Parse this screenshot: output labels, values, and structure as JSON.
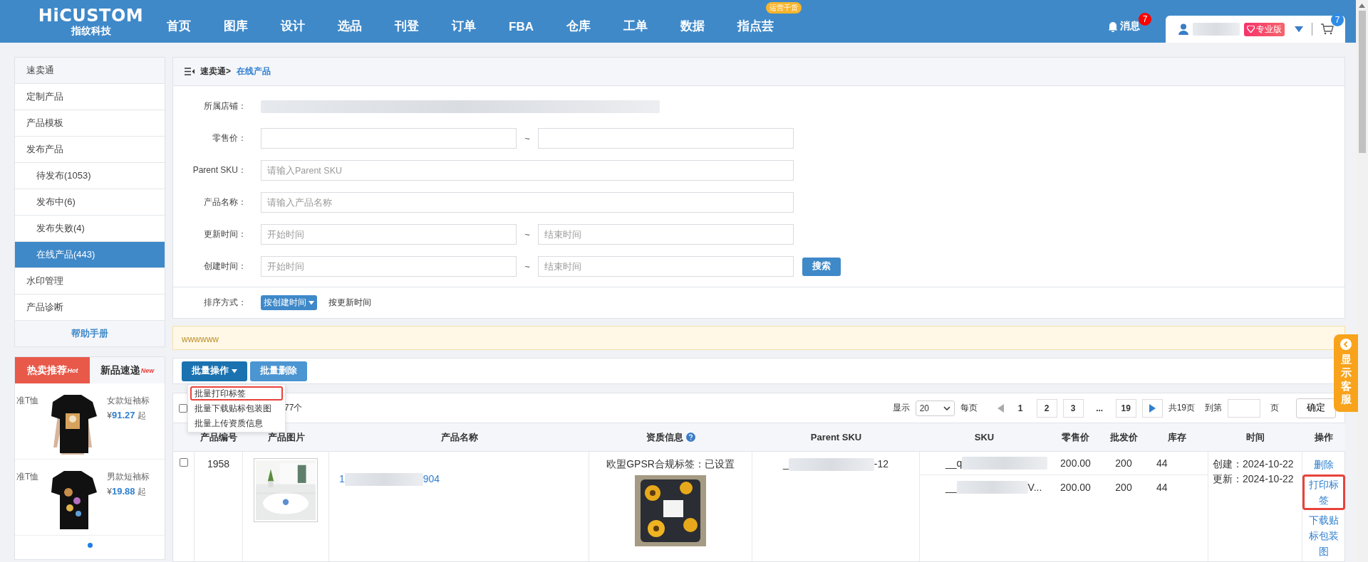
{
  "header": {
    "logo": {
      "title": "HiCUSTOM",
      "subtitle": "指纹科技"
    },
    "nav": [
      {
        "label": "首页"
      },
      {
        "label": "图库"
      },
      {
        "label": "设计"
      },
      {
        "label": "选品"
      },
      {
        "label": "刊登"
      },
      {
        "label": "订单"
      },
      {
        "label": "FBA"
      },
      {
        "label": "仓库"
      },
      {
        "label": "工单"
      },
      {
        "label": "数据"
      },
      {
        "label": "指点芸",
        "badge": "运营干货"
      }
    ],
    "messages": {
      "label": "消息",
      "count": "7"
    },
    "user": {
      "badge": "专业版"
    },
    "cart": {
      "count": "7"
    }
  },
  "sidebar": {
    "title": "速卖通",
    "items": [
      {
        "label": "定制产品",
        "selected": false
      },
      {
        "label": "产品模板",
        "selected": false
      },
      {
        "label": "发布产品",
        "selected": false,
        "children": [
          {
            "label": "待发布(1053)",
            "selected": false
          },
          {
            "label": "发布中(6)",
            "selected": false
          },
          {
            "label": "发布失败(4)",
            "selected": false
          },
          {
            "label": "在线产品(443)",
            "selected": true
          }
        ]
      },
      {
        "label": "水印管理",
        "selected": false
      },
      {
        "label": "产品诊断",
        "selected": false
      }
    ],
    "help": "帮助手册"
  },
  "promo": {
    "tabs": [
      {
        "label": "热卖推荐",
        "tag": "Hot",
        "selected": true
      },
      {
        "label": "新品速递",
        "tag": "New",
        "selected": false
      }
    ],
    "items": [
      {
        "left_text": "准T恤",
        "name": "女款短袖标",
        "currency": "¥",
        "price": "91.27",
        "suffix": "起"
      },
      {
        "left_text": "准T恤",
        "name": "男款短袖标",
        "currency": "¥",
        "price": "19.88",
        "suffix": "起"
      }
    ]
  },
  "breadcrumb": {
    "root": "速卖通>",
    "current": "在线产品"
  },
  "filters": [
    {
      "label": "所属店铺：",
      "kind": "redacted"
    },
    {
      "label": "零售价：",
      "kind": "range",
      "separator": "~"
    },
    {
      "label": "Parent SKU：",
      "kind": "text",
      "placeholder": "请输入Parent SKU"
    },
    {
      "label": "产品名称：",
      "kind": "text",
      "placeholder": "请输入产品名称"
    },
    {
      "label": "更新时间：",
      "kind": "range",
      "separator": "~",
      "placeholders": [
        "开始时间",
        "结束时间"
      ]
    },
    {
      "label": "创建时间：",
      "kind": "range",
      "separator": "~",
      "placeholders": [
        "开始时间",
        "结束时间"
      ],
      "button": "搜索"
    }
  ],
  "sort": {
    "label": "排序方式：",
    "options": [
      {
        "label": "按创建时间",
        "selected": true
      },
      {
        "label": "按更新时间",
        "selected": false
      }
    ]
  },
  "notice": "wwwwww",
  "toolbar": {
    "buttons": [
      {
        "label": "批量操作",
        "kind": "dropdown"
      },
      {
        "label": "批量删除",
        "kind": "plain"
      }
    ],
    "menu": [
      {
        "label": "批量打印标签",
        "highlighted": true
      },
      {
        "label": "批量下载贴标包装图",
        "highlighted": false
      },
      {
        "label": "批量上传资质信息",
        "highlighted": false
      }
    ]
  },
  "summary": {
    "checked": false,
    "text": "77个"
  },
  "pagination": {
    "show_label": "显示",
    "page_size": "20",
    "per_page_label": "每页",
    "pages": [
      {
        "label": "1",
        "selected": true
      },
      {
        "label": "2",
        "selected": false
      },
      {
        "label": "3",
        "selected": false
      },
      {
        "label": "...",
        "kind": "ellipsis"
      },
      {
        "label": "19",
        "selected": false
      }
    ],
    "total": "共19页",
    "goto_label": "到第",
    "page_suffix": "页",
    "confirm": "确定"
  },
  "table": {
    "columns": [
      {
        "label": "产品编号"
      },
      {
        "label": "产品图片"
      },
      {
        "label": "产品名称"
      },
      {
        "label": "资质信息",
        "help": true
      },
      {
        "label": "Parent SKU"
      },
      {
        "label": "SKU"
      },
      {
        "label": "零售价"
      },
      {
        "label": "批发价"
      },
      {
        "label": "库存"
      },
      {
        "label": "时间"
      },
      {
        "label": "操作"
      }
    ],
    "rows": [
      {
        "checked": false,
        "id": "1958",
        "name_prefix": "1",
        "name_suffix": "904",
        "qualification": "欧盟GPSR合规标签：已设置",
        "parent_sku_prefix": "_",
        "parent_sku_suffix": "-12",
        "variants": [
          {
            "sku_prefix": "__q",
            "retail": "200.00",
            "wholesale": "200",
            "stock": "44"
          },
          {
            "sku_prefix": "__",
            "sku_suffix": "V...",
            "retail": "200.00",
            "wholesale": "200",
            "stock": "44"
          }
        ],
        "created": "创建：2024-10-22",
        "updated": "更新：2024-10-22",
        "actions": [
          {
            "label": "删除",
            "highlighted": false
          },
          {
            "label": "打印标签",
            "highlighted": true
          },
          {
            "label": "下载贴标包装图",
            "highlighted": false
          }
        ]
      }
    ]
  },
  "service_tab": "显示客服"
}
